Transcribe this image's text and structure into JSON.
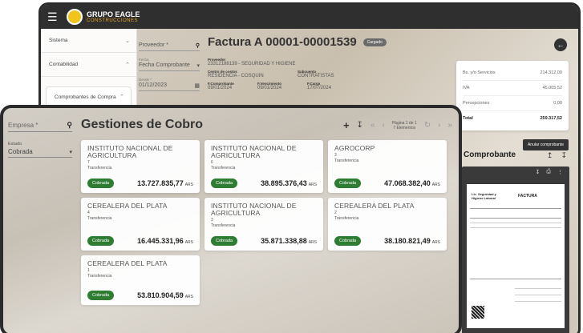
{
  "back": {
    "logo": {
      "title": "GRUPO EAGLE",
      "subtitle": "CONSTRUCCIONES"
    },
    "sidebar": [
      {
        "label": "Sistema"
      },
      {
        "label": "Contabilidad"
      },
      {
        "label": "Comprobantes de Compra"
      }
    ],
    "filters": {
      "proveedor_placeholder": "Proveedor *",
      "fecha_label": "Fecha",
      "fecha_value": "Fecha Comprobante",
      "desde_label": "Desde *",
      "desde_value": "01/12/2023"
    },
    "factura": {
      "title": "Factura A 00001-00001539",
      "status": "Cargado",
      "proveedor_label": "Proveedor",
      "proveedor_value": "23312188139 - SEGURIDAD Y HIGIENE",
      "centro_label": "Centro de costos",
      "centro_value": "RESIDENCIA - COSQUIN",
      "subcuenta_label": "Subcuenta",
      "subcuenta_value": "CONTRATISTAS",
      "fcomp_label": "F.Comprobante",
      "fcomp_value": "09/01/2024",
      "fvenc_label": "F.Vencimiento",
      "fvenc_value": "09/01/2024",
      "fcarga_label": "F.Carga",
      "fcarga_value": "17/07/2024"
    },
    "totals": [
      {
        "label": "Bs. y/o Servicios",
        "value": "214.312,00"
      },
      {
        "label": "IVA",
        "value": "45.005,52"
      },
      {
        "label": "Percepciones",
        "value": "0,00"
      },
      {
        "label": "Total",
        "value": "259.317,52"
      }
    ],
    "anular_label": "Anular comprobante",
    "comprobante_title": "Comprobante",
    "pdf": {
      "company": "Lic. Seguridad y Higiene Laboral",
      "doc": "FACTURA"
    }
  },
  "front": {
    "filters": {
      "empresa_placeholder": "Empresa *",
      "estado_label": "Estado",
      "estado_value": "Cobrada"
    },
    "title": "Gestiones de Cobro",
    "pager": {
      "line1": "Página 1 de 1",
      "line2": "7 Elementos"
    },
    "cards": [
      {
        "name": "INSTITUTO NACIONAL DE AGRICULTURA",
        "count": "7",
        "tipo": "Transferencia",
        "estado": "Cobrada",
        "amount": "13.727.835,77",
        "currency": "ARS"
      },
      {
        "name": "INSTITUTO NACIONAL DE AGRICULTURA",
        "count": "6",
        "tipo": "Transferencia",
        "estado": "Cobrada",
        "amount": "38.895.376,43",
        "currency": "ARS"
      },
      {
        "name": "AGROCORP",
        "count": "3",
        "tipo": "Transferencia",
        "estado": "Cobrada",
        "amount": "47.068.382,40",
        "currency": "ARS"
      },
      {
        "name": "CEREALERA DEL PLATA",
        "count": "4",
        "tipo": "Transferencia",
        "estado": "Cobrada",
        "amount": "16.445.331,96",
        "currency": "ARS"
      },
      {
        "name": "INSTITUTO NACIONAL DE AGRICULTURA",
        "count": "3",
        "tipo": "Transferencia",
        "estado": "Cobrada",
        "amount": "35.871.338,88",
        "currency": "ARS"
      },
      {
        "name": "CEREALERA DEL PLATA",
        "count": "2",
        "tipo": "Transferencia",
        "estado": "Cobrada",
        "amount": "38.180.821,49",
        "currency": "ARS"
      },
      {
        "name": "CEREALERA DEL PLATA",
        "count": "1",
        "tipo": "Transferencia",
        "estado": "Cobrada",
        "amount": "53.810.904,59",
        "currency": "ARS"
      }
    ]
  },
  "colors": {
    "badge_green": "#2e7d32",
    "topbar": "#2f2f2f",
    "logo_yellow": "#f0c419"
  }
}
